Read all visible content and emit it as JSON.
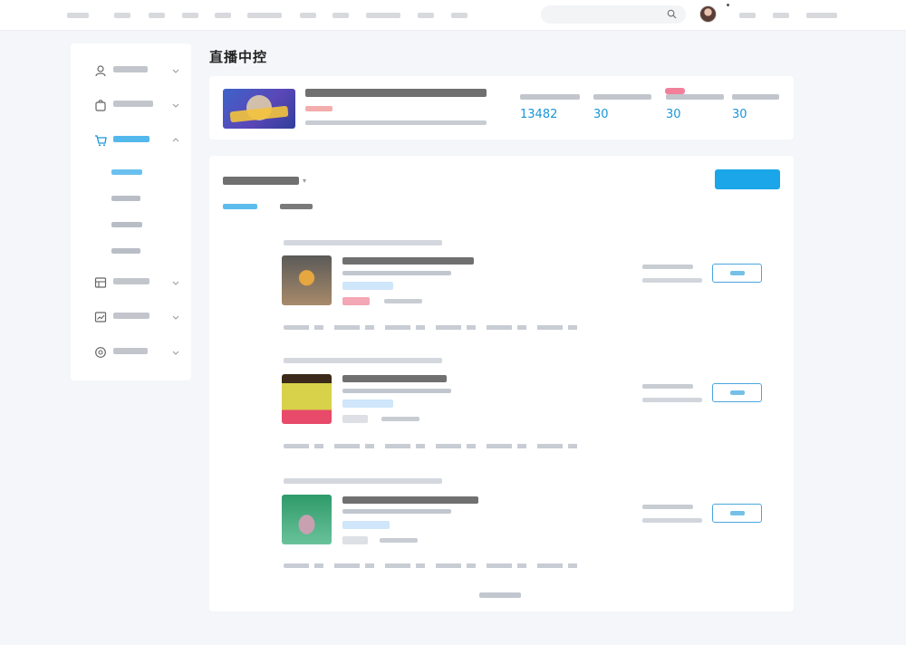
{
  "nav": {
    "items": [
      "",
      "",
      "",
      "",
      "",
      "",
      "",
      "",
      "",
      "",
      ""
    ],
    "search_placeholder": "",
    "right": [
      "",
      "",
      ""
    ]
  },
  "sidebar": {
    "items": [
      {
        "label": "",
        "icon": "user-icon"
      },
      {
        "label": "",
        "icon": "bag-icon"
      },
      {
        "label": "",
        "icon": "cart-icon",
        "active": true
      },
      {
        "label": "",
        "icon": "shop-icon"
      },
      {
        "label": "",
        "icon": "chart-icon"
      },
      {
        "label": "",
        "icon": "settings-icon"
      }
    ],
    "subitems": [
      "",
      "",
      "",
      ""
    ]
  },
  "page": {
    "title": "直播中控"
  },
  "live": {
    "title": "",
    "tag": "",
    "meta": "",
    "stats": [
      {
        "label": "",
        "value": "13482",
        "unit": ""
      },
      {
        "label": "",
        "value": "30",
        "unit": ""
      },
      {
        "label": "",
        "value": "30",
        "unit": ""
      },
      {
        "label": "",
        "value": "30",
        "unit": ""
      }
    ]
  },
  "products": {
    "title": "",
    "add_button": "",
    "tabs": [
      {
        "label": "",
        "count": ""
      },
      {
        "label": "",
        "count": ""
      }
    ],
    "rows": [
      {
        "seq": "",
        "edit": ""
      },
      {
        "seq": "",
        "edit": ""
      },
      {
        "seq": "",
        "edit": ""
      }
    ],
    "more": ""
  },
  "colors": {
    "accent": "#1aa6e8",
    "badge": "#f06a8a"
  }
}
